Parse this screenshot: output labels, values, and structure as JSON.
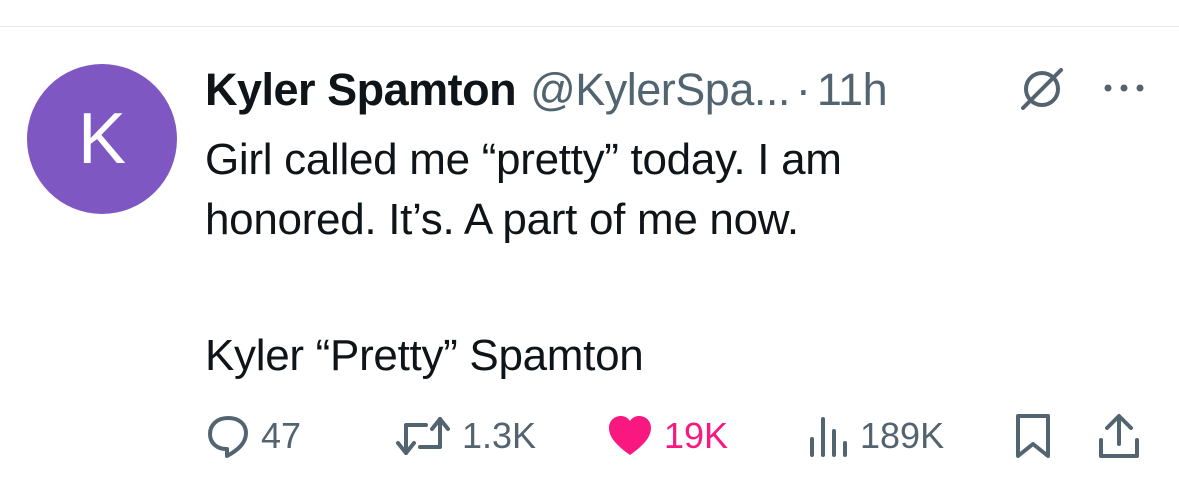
{
  "post": {
    "avatar_letter": "K",
    "author_name": "Kyler Spamton",
    "author_handle": "@KylerSpa...",
    "separator": "·",
    "timestamp": "11h",
    "text": "Girl called me “pretty” today. I am\nhonored. It’s. A part of me now.",
    "signature": "Kyler “Pretty” Spamton"
  },
  "actions": {
    "replies": "47",
    "reposts": "1.3K",
    "likes": "19K",
    "views": "189K"
  },
  "icons": {
    "avatar": "avatar",
    "grok": "grok-icon",
    "more": "more-icon",
    "reply": "reply-icon",
    "repost": "repost-icon",
    "like": "heart-icon",
    "views": "views-icon",
    "bookmark": "bookmark-icon",
    "share": "share-icon"
  },
  "colors": {
    "avatar_bg": "#7e57c2",
    "text_primary": "#0f1419",
    "text_secondary": "#536471",
    "like_active": "#f91880"
  }
}
